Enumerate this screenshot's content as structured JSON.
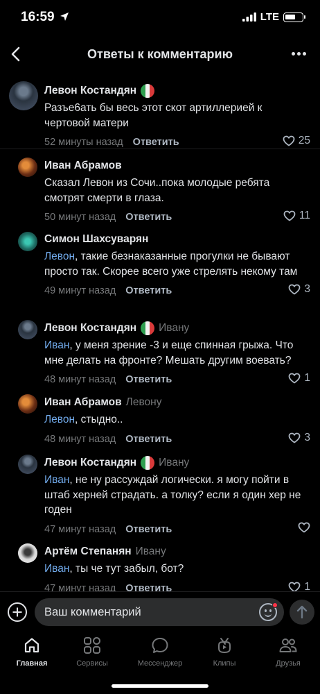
{
  "status_bar": {
    "time": "16:59",
    "network": "LTE"
  },
  "nav": {
    "title": "Ответы к комментарию"
  },
  "comments": [
    {
      "author": "Левон Костандян",
      "flag": "italy-flag",
      "reply_to": "",
      "mention": "",
      "text": "Разъе6ать бы весь этот скот артиллерией к чертовой матери",
      "time": "52 минуты назад",
      "answer": "Ответить",
      "likes": "25"
    },
    {
      "author": "Иван Абрамов",
      "flag": "",
      "reply_to": "",
      "mention": "",
      "text": "Сказал Левон из Сочи..пока молодые ребята смотрят смерти в глаза.",
      "time": "50 минут назад",
      "answer": "Ответить",
      "likes": "11"
    },
    {
      "author": "Симон Шахсуварян",
      "flag": "",
      "reply_to": "",
      "mention": "Левон",
      "text": ", такие безнаказанные прогулки не бывают просто так. Скорее всего уже стрелять некому там",
      "time": "49 минут назад",
      "answer": "Ответить",
      "likes": "3"
    },
    {
      "author": "Левон Костандян",
      "flag": "italy-flag",
      "reply_to": "Ивану",
      "mention": "Иван",
      "text": ", у меня зрение -3 и еще спинная грыжа. Что мне делать на  фронте? Мешать другим воевать?",
      "time": "48 минут назад",
      "answer": "Ответить",
      "likes": "1"
    },
    {
      "author": "Иван Абрамов",
      "flag": "",
      "reply_to": "Левону",
      "mention": "Левон",
      "text": ", стыдно..",
      "time": "48 минут назад",
      "answer": "Ответить",
      "likes": "3"
    },
    {
      "author": "Левон Костандян",
      "flag": "italy-flag",
      "reply_to": "Ивану",
      "mention": "Иван",
      "text": ", не ну рассуждай логически. я могу пойти в штаб херней страдать. а толку? если я один хер не годен",
      "time": "47 минут назад",
      "answer": "Ответить",
      "likes": ""
    },
    {
      "author": "Артём Степанян",
      "flag": "",
      "reply_to": "Ивану",
      "mention": "Иван",
      "text": ", ты че тут забыл, бот?",
      "time": "47 минут назад",
      "answer": "Ответить",
      "likes": "1"
    }
  ],
  "composer": {
    "placeholder": "Ваш комментарий"
  },
  "tabs": [
    {
      "label": "Главная",
      "icon": "home-icon"
    },
    {
      "label": "Сервисы",
      "icon": "services-icon"
    },
    {
      "label": "Мессенджер",
      "icon": "messenger-icon"
    },
    {
      "label": "Клипы",
      "icon": "clips-icon"
    },
    {
      "label": "Друзья",
      "icon": "friends-icon"
    }
  ],
  "colors": {
    "background": "#000000",
    "text": "#e1e3e6",
    "secondary": "#76787a",
    "link": "#71aaeb",
    "input_bg": "#2c2d2e"
  }
}
